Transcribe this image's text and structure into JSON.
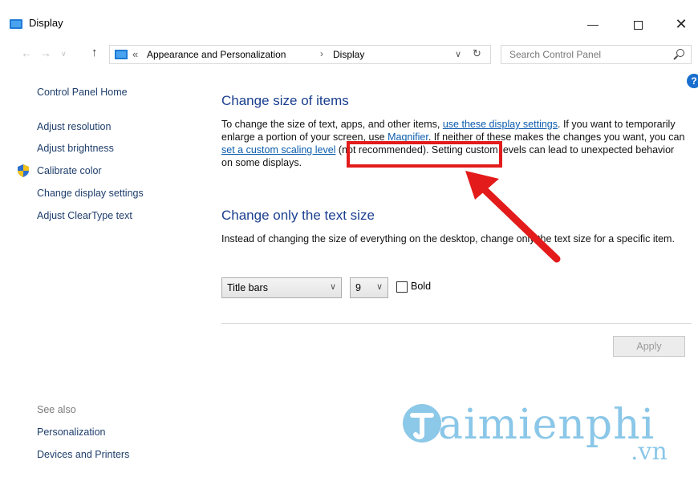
{
  "window": {
    "title": "Display",
    "minimize_glyph": "—",
    "close_glyph": "✕"
  },
  "address_bar": {
    "chevrons": "«",
    "crumbs": [
      "Appearance and Personalization",
      "Display"
    ],
    "separator": "›",
    "dropdown_glyph": "∨",
    "refresh_glyph": "↻"
  },
  "search": {
    "placeholder": "Search Control Panel"
  },
  "help": {
    "glyph": "?"
  },
  "sidebar": {
    "home": "Control Panel Home",
    "items": [
      "Adjust resolution",
      "Adjust brightness",
      "Calibrate color",
      "Change display settings",
      "Adjust ClearType text"
    ],
    "see_also_title": "See also",
    "see_also": [
      "Personalization",
      "Devices and Printers"
    ]
  },
  "main": {
    "section1": {
      "heading": "Change size of items",
      "text_a": "To change the size of text, apps, and other items, ",
      "link_a": "use these display settings",
      "text_b": ".  If you want to temporarily enlarge a portion of your screen, use ",
      "link_b": "Magnifier",
      "text_c": ".  If neither of these makes the changes you want, you can ",
      "link_c": "set a custom scaling level",
      "text_d": " (not recommended).  Setting custom levels can lead to unexpected behavior on some displays."
    },
    "section2": {
      "heading": "Change only the text size",
      "text": "Instead of changing the size of everything on the desktop, change only the text size for a specific item.",
      "item_select": {
        "value": "Title bars"
      },
      "size_select": {
        "value": "9"
      },
      "bold_label": "Bold",
      "bold_checked": false
    },
    "apply_label": "Apply"
  },
  "watermark": {
    "text": "aimienphi",
    "suffix": ".vn"
  },
  "colors": {
    "link": "#0b5cad",
    "heading": "#1a3f8f",
    "annotation": "#e31b1b",
    "watermark": "#2e9bd6"
  }
}
